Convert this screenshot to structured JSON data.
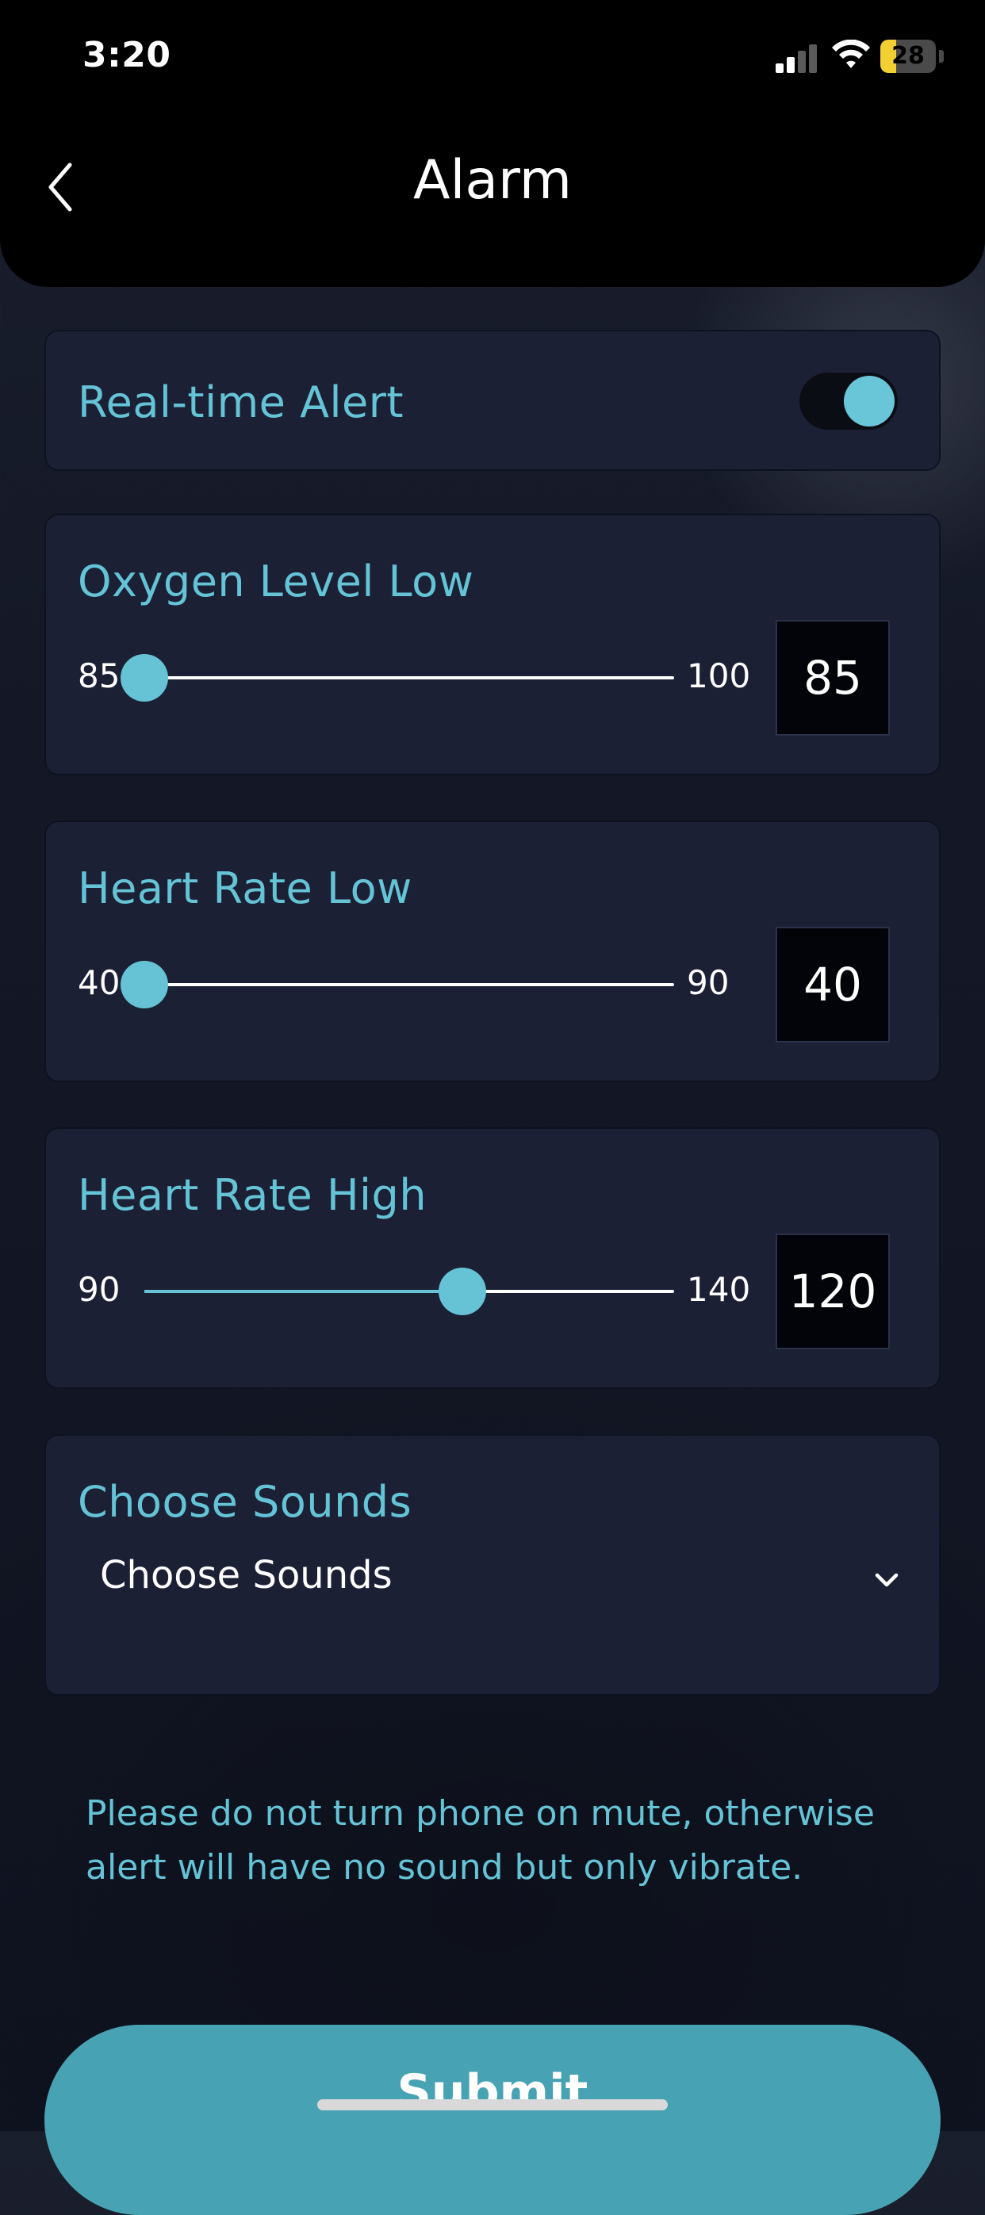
{
  "status_bar": {
    "time": "3:20",
    "battery_level": "28",
    "battery_fraction": 0.28,
    "signal_bars_active": 2,
    "signal_bars_total": 4,
    "icons": [
      "cellular-signal-icon",
      "wifi-icon",
      "battery-icon"
    ]
  },
  "header": {
    "title": "Alarm",
    "back_icon": "chevron-left-icon"
  },
  "realtime_alert": {
    "label": "Real-time Alert",
    "enabled": true
  },
  "oxygen_low": {
    "label": "Oxygen Level Low",
    "min": "85",
    "max": "100",
    "value": "85",
    "fraction": 0.0
  },
  "heart_rate_low": {
    "label": "Heart Rate Low",
    "min": "40",
    "max": "90",
    "value": "40",
    "fraction": 0.0
  },
  "heart_rate_high": {
    "label": "Heart Rate High",
    "min": "90",
    "max": "140",
    "value": "120",
    "fraction": 0.6
  },
  "sounds": {
    "label": "Choose Sounds",
    "selected": "Choose Sounds",
    "icon": "chevron-down-icon"
  },
  "notice": {
    "text": "Please do not turn phone on mute, otherwise alert will have no sound but only vibrate."
  },
  "submit": {
    "label": "Submit"
  },
  "colors": {
    "accent": "#65c3d6",
    "button": "#47a2b3",
    "card": "#1b2035",
    "header": "#000000"
  }
}
